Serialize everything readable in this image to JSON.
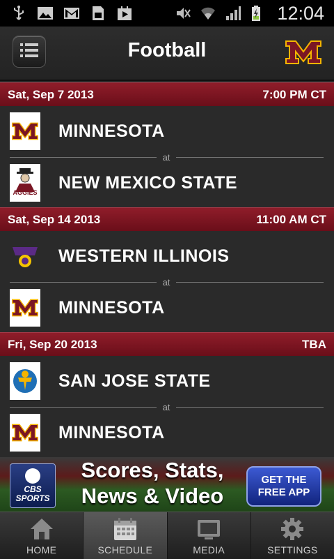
{
  "status_bar": {
    "time": "12:04",
    "left_icons": [
      "usb-icon",
      "image-icon",
      "gmail-icon",
      "sim-icon",
      "play-store-icon"
    ],
    "right_icons": [
      "mute-icon",
      "wifi-icon",
      "signal-icon",
      "battery-charging-icon"
    ]
  },
  "header": {
    "title": "Football",
    "menu_icon": "list-icon",
    "logo_text": "M"
  },
  "games": [
    {
      "date": "Sat, Sep 7 2013",
      "time": "7:00 PM CT",
      "away": {
        "name": "MINNESOTA",
        "logo": "minnesota-logo"
      },
      "separator": "at",
      "home": {
        "name": "NEW MEXICO STATE",
        "logo": "nmsu-aggies-logo"
      }
    },
    {
      "date": "Sat, Sep 14 2013",
      "time": "11:00 AM CT",
      "away": {
        "name": "WESTERN ILLINOIS",
        "logo": "western-illinois-logo"
      },
      "separator": "at",
      "home": {
        "name": "MINNESOTA",
        "logo": "minnesota-logo"
      }
    },
    {
      "date": "Fri, Sep 20 2013",
      "time": "TBA",
      "away": {
        "name": "SAN JOSE STATE",
        "logo": "san-jose-state-logo"
      },
      "separator": "at",
      "home": {
        "name": "MINNESOTA",
        "logo": "minnesota-logo"
      }
    }
  ],
  "ad": {
    "brand_line1": "CBS",
    "brand_line2": "SPORTS",
    "headline_line1": "Scores, Stats,",
    "headline_line2": "News & Video",
    "cta_line1": "GET THE",
    "cta_line2": "FREE APP"
  },
  "tabs": [
    {
      "label": "HOME",
      "icon": "home-icon",
      "active": false
    },
    {
      "label": "SCHEDULE",
      "icon": "calendar-icon",
      "active": true
    },
    {
      "label": "MEDIA",
      "icon": "tv-icon",
      "active": false
    },
    {
      "label": "SETTINGS",
      "icon": "gear-icon",
      "active": false
    }
  ],
  "colors": {
    "maroon": "#7a1624",
    "gold": "#f5b400",
    "background": "#2a2a2a"
  }
}
